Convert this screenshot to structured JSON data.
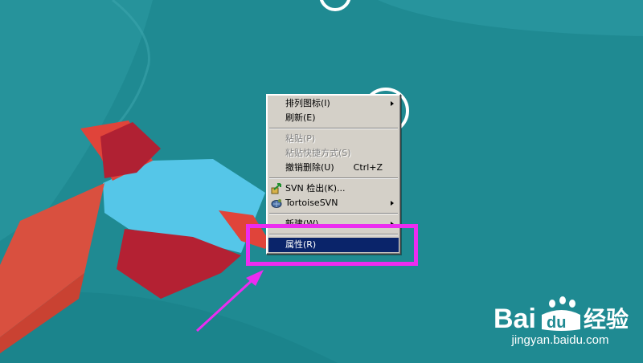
{
  "menu": {
    "items": [
      {
        "label": "排列图标(I)",
        "submenu": true,
        "disabled": false
      },
      {
        "label": "刷新(E)",
        "disabled": false
      },
      {
        "separator": true
      },
      {
        "label": "粘贴(P)",
        "disabled": true
      },
      {
        "label": "粘贴快捷方式(S)",
        "disabled": true
      },
      {
        "label": "撤销删除(U)",
        "shortcut": "Ctrl+Z",
        "disabled": false
      },
      {
        "separator": true
      },
      {
        "label": "SVN 检出(K)...",
        "icon": "svn-checkout-icon",
        "disabled": false
      },
      {
        "label": "TortoiseSVN",
        "icon": "tortoisesvn-icon",
        "submenu": true,
        "disabled": false
      },
      {
        "separator": true
      },
      {
        "label": "新建(W)",
        "submenu": true,
        "disabled": false
      },
      {
        "separator": true
      },
      {
        "label": "属性(R)",
        "selected": true,
        "disabled": false
      }
    ]
  },
  "colors": {
    "desktop_bg": "#1f8a92",
    "menu_bg": "#d4d0c8",
    "selection": "#0a246a",
    "highlight_annotation": "#ec2cf0"
  },
  "watermark": {
    "brand_lettering": "Bai du 经验",
    "url": "jingyan.baidu.com"
  }
}
